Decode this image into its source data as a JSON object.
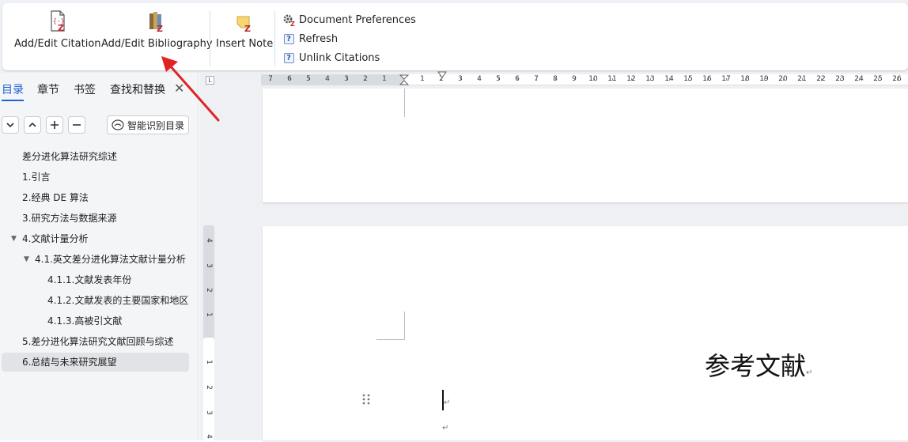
{
  "ribbon": {
    "add_edit_citation": "Add/Edit Citation",
    "add_edit_bibliography": "Add/Edit Bibliography",
    "insert_note": "Insert Note",
    "document_preferences": "Document Preferences",
    "refresh": "Refresh",
    "unlink_citations": "Unlink Citations"
  },
  "nav": {
    "tabs": [
      "目录",
      "章节",
      "书签",
      "查找和替换"
    ],
    "active_tab": "目录",
    "smart_toc_label": "智能识别目录",
    "toc": [
      {
        "label": "差分进化算法研究综述",
        "level": 0
      },
      {
        "label": "1.引言",
        "level": 0
      },
      {
        "label": "2.经典 DE 算法",
        "level": 0
      },
      {
        "label": "3.研究方法与数据来源",
        "level": 0
      },
      {
        "label": "4.文献计量分析",
        "level": 0,
        "expanded": true
      },
      {
        "label": "4.1.英文差分进化算法文献计量分析",
        "level": 1,
        "expanded": true
      },
      {
        "label": "4.1.1.文献发表年份",
        "level": 2
      },
      {
        "label": "4.1.2.文献发表的主要国家和地区",
        "level": 2
      },
      {
        "label": "4.1.3.高被引文献",
        "level": 2
      },
      {
        "label": "5.差分进化算法研究文献回顾与综述",
        "level": 0
      },
      {
        "label": "6.总结与未来研究展望",
        "level": 0,
        "selected": true
      }
    ]
  },
  "ruler": {
    "left_numbers": [
      "7",
      "6",
      "5",
      "4",
      "3",
      "2",
      "1"
    ],
    "right_numbers": [
      "1",
      "2",
      "3",
      "4",
      "5",
      "6",
      "7",
      "8",
      "9",
      "10",
      "11",
      "12",
      "13",
      "14",
      "15",
      "16",
      "17",
      "18",
      "19",
      "20",
      "21",
      "22",
      "23",
      "24",
      "25",
      "26"
    ],
    "vertical_numbers": [
      "4",
      "3",
      "2",
      "1",
      "1",
      "2",
      "3",
      "4"
    ]
  },
  "document": {
    "heading": "参考文献",
    "return_mark": "↵"
  },
  "colors": {
    "accent": "#1c63d6",
    "annotation_arrow": "#e02424"
  }
}
